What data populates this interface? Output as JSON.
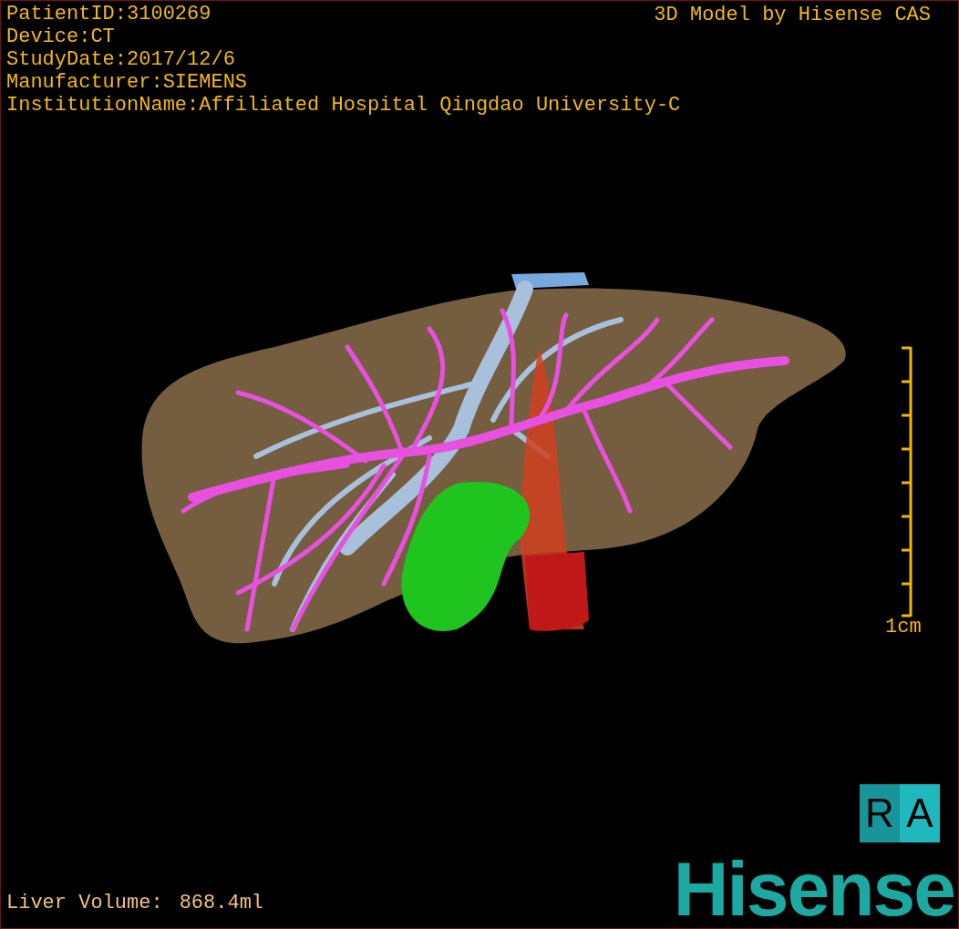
{
  "patient_info": [
    "PatientID:3100269",
    "Device:CT",
    "StudyDate:2017/12/6",
    "Manufacturer:SIEMENS",
    "InstitutionName:Affiliated Hospital Qingdao University-C"
  ],
  "title": "3D Model by Hisense CAS",
  "scale_bar": {
    "label": "1cm"
  },
  "orientation_cube": {
    "letters": [
      "R",
      "A"
    ]
  },
  "liver_volume": {
    "label": "Liver Volume:",
    "value": "868.4ml"
  },
  "logo": "Hisense"
}
